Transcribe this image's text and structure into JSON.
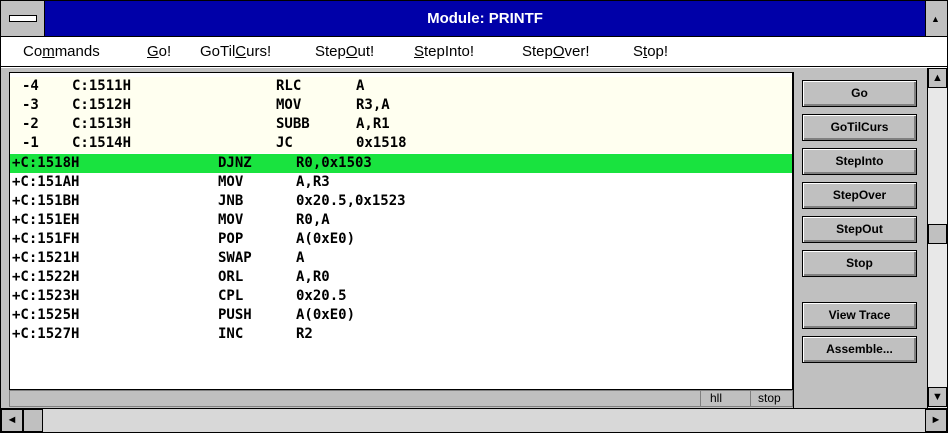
{
  "window": {
    "title": "Module: PRINTF",
    "sysmenu_icon": "system-menu-icon",
    "max_icon": "maximize-icon"
  },
  "menu": {
    "items": [
      {
        "pre": "Co",
        "mn": "m",
        "post": "mands"
      },
      {
        "pre": "",
        "mn": "G",
        "post": "o!"
      },
      {
        "pre": "GoTil",
        "mn": "C",
        "post": "urs!"
      },
      {
        "pre": "Step",
        "mn": "O",
        "post": "ut!"
      },
      {
        "pre": "",
        "mn": "S",
        "post": "tepInto!"
      },
      {
        "pre": "Step",
        "mn": "O",
        "post": "ver!"
      },
      {
        "pre": "S",
        "mn": "t",
        "post": "op!"
      }
    ]
  },
  "code": {
    "pre_rows": [
      {
        "idx": "-4",
        "addr": "C:1511H",
        "op": "RLC",
        "args": "A"
      },
      {
        "idx": "-3",
        "addr": "C:1512H",
        "op": "MOV",
        "args": "R3,A"
      },
      {
        "idx": "-2",
        "addr": "C:1513H",
        "op": "SUBB",
        "args": "A,R1"
      },
      {
        "idx": "-1",
        "addr": "C:1514H",
        "op": "JC",
        "args": "0x1518"
      }
    ],
    "rows": [
      {
        "addr": "+C:1518H",
        "op": "DJNZ",
        "args": "R0,0x1503"
      },
      {
        "addr": "+C:151AH",
        "op": "MOV",
        "args": "A,R3"
      },
      {
        "addr": "+C:151BH",
        "op": "JNB",
        "args": "0x20.5,0x1523"
      },
      {
        "addr": "+C:151EH",
        "op": "MOV",
        "args": "R0,A"
      },
      {
        "addr": "+C:151FH",
        "op": "POP",
        "args": "A(0xE0)"
      },
      {
        "addr": "+C:1521H",
        "op": "SWAP",
        "args": "A"
      },
      {
        "addr": "+C:1522H",
        "op": "ORL",
        "args": "A,R0"
      },
      {
        "addr": "+C:1523H",
        "op": "CPL",
        "args": "0x20.5"
      },
      {
        "addr": "+C:1525H",
        "op": "PUSH",
        "args": "A(0xE0)"
      },
      {
        "addr": "+C:1527H",
        "op": "INC",
        "args": "R2"
      }
    ],
    "current_row_color": "#19e33f"
  },
  "status": {
    "hll": "hll",
    "state": "stop"
  },
  "buttons": {
    "go": "Go",
    "gotilcurs": "GoTilCurs",
    "stepinto": "StepInto",
    "stepover": "StepOver",
    "stepout": "StepOut",
    "stop": "Stop",
    "viewtrace": "View Trace",
    "assemble": "Assemble..."
  },
  "scroll": {
    "up": "▲",
    "down": "▼",
    "left": "◄",
    "right": "►"
  }
}
